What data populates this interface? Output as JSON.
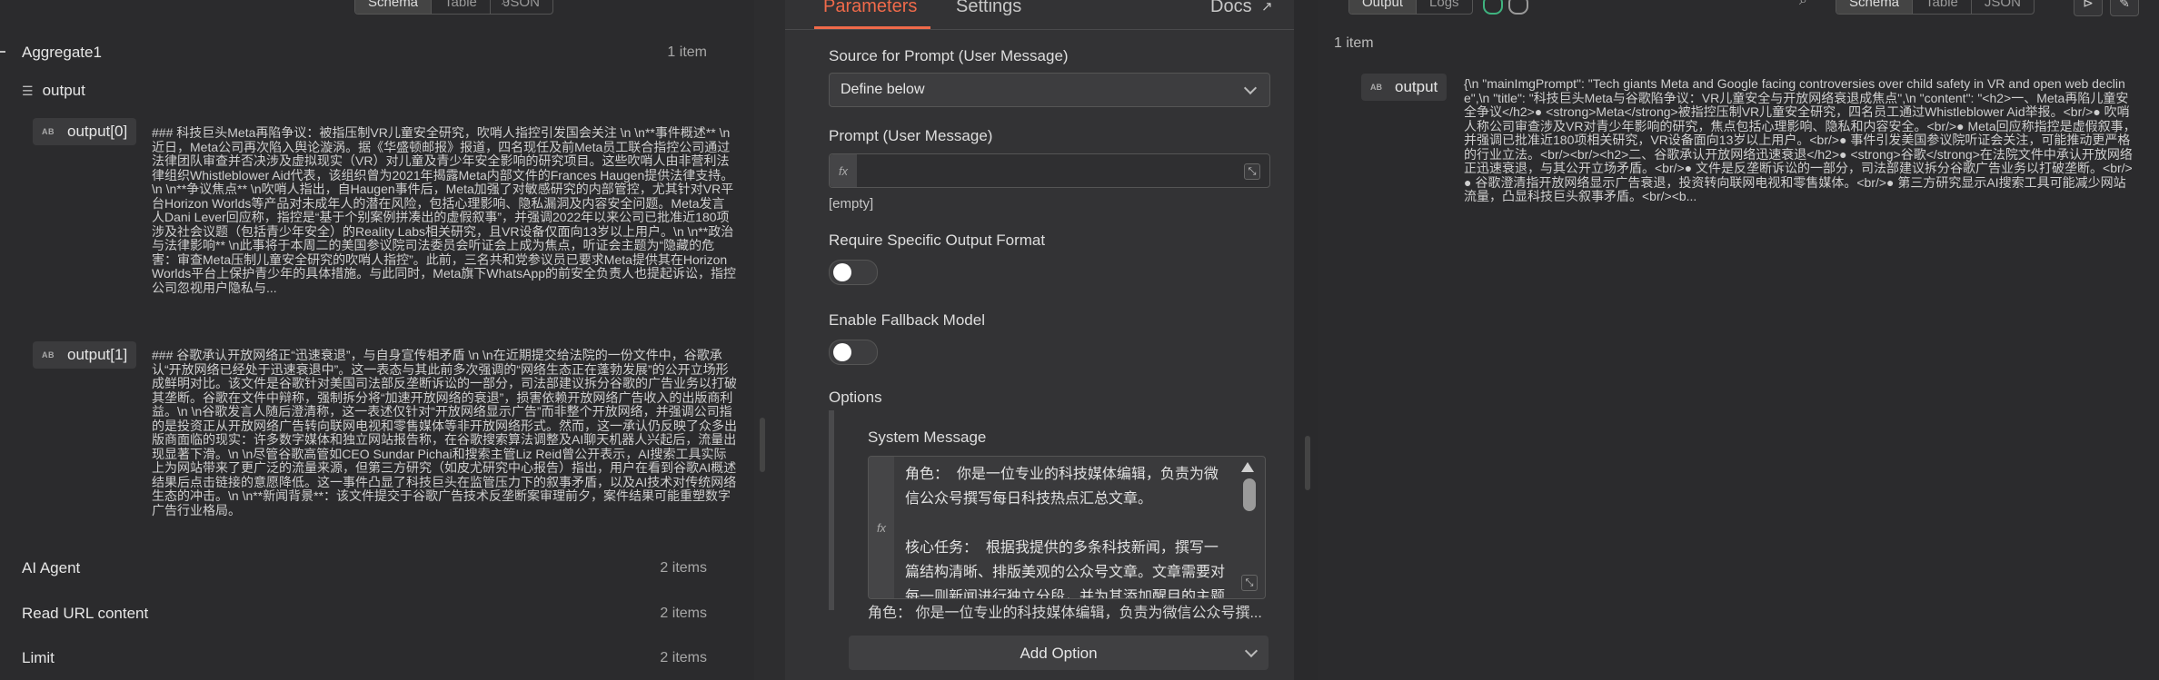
{
  "left": {
    "top_toggle": [
      "Schema",
      "Table",
      "JSON"
    ],
    "nodes": [
      {
        "name": "Aggregate1",
        "count": "1 item"
      },
      {
        "name": "AI Agent",
        "count": "2 items"
      },
      {
        "name": "Read URL content",
        "count": "2 items"
      },
      {
        "name": "Limit",
        "count": "2 items"
      }
    ],
    "output_label": "output",
    "output_icon": "list-icon",
    "field_type_badge": "AB",
    "item0": {
      "key": "output[0]",
      "text": "### 科技巨头Meta再陷争议：被指压制VR儿童安全研究，吹哨人指控引发国会关注 \\n \\n**事件概述** \\n近日，Meta公司再次陷入舆论漩涡。据《华盛顿邮报》报道，四名现任及前Meta员工联合指控公司通过法律团队审查并否决涉及虚拟现实（VR）对儿童及青少年安全影响的研究项目。这些吹哨人由非营利法律组织Whistleblower Aid代表，该组织曾为2021年揭露Meta内部文件的Frances Haugen提供法律支持。\\n \\n**争议焦点** \\n吹哨人指出，自Haugen事件后，Meta加强了对敏感研究的内部管控，尤其针对VR平台Horizon Worlds等产品对未成年人的潜在风险，包括心理影响、隐私漏洞及内容安全问题。Meta发言人Dani Lever回应称，指控是“基于个别案例拼凑出的虚假叙事”，并强调2022年以来公司已批准近180项涉及社会议题（包括青少年安全）的Reality Labs相关研究，且VR设备仅面向13岁以上用户。\\n \\n**政治与法律影响** \\n此事将于本周二的美国参议院司法委员会听证会上成为焦点，听证会主题为“隐藏的危害：审查Meta压制儿童安全研究的吹哨人指控”。此前，三名共和党参议员已要求Meta提供其在Horizon Worlds平台上保护青少年的具体措施。与此同时，Meta旗下WhatsApp的前安全负责人也提起诉讼，指控公司忽视用户隐私与..."
    },
    "item1": {
      "key": "output[1]",
      "text": "### 谷歌承认开放网络正“迅速衰退”，与自身宣传相矛盾 \\n \\n在近期提交给法院的一份文件中，谷歌承认“开放网络已经处于迅速衰退中”。这一表态与其此前多次强调的“网络生态正在蓬勃发展”的公开立场形成鲜明对比。该文件是谷歌针对美国司法部反垄断诉讼的一部分，司法部建议拆分谷歌的广告业务以打破其垄断。谷歌在文件中辩称，强制拆分将“加速开放网络的衰退”，损害依赖开放网络广告收入的出版商利益。\\n \\n谷歌发言人随后澄清称，这一表述仅针对“开放网络显示广告”而非整个开放网络，并强调公司指的是投资正从开放网络广告转向联网电视和零售媒体等非开放网络形式。然而，这一承认仍反映了众多出版商面临的现实：许多数字媒体和独立网站报告称，在谷歌搜索算法调整及AI聊天机器人兴起后，流量出现显著下滑。\\n \\n尽管谷歌高管如CEO Sundar Pichai和搜索主管Liz Reid曾公开表示，AI搜索工具实际上为网站带来了更广泛的流量来源，但第三方研究（如皮尤研究中心报告）指出，用户在看到谷歌AI概述结果后点击链接的意愿降低。这一事件凸显了科技巨头在监管压力下的叙事矛盾，以及AI技术对传统网络生态的冲击。\\n \\n**新闻背景**：该文件提交于谷歌广告技术反垄断案审理前夕，案件结果可能重塑数字广告行业格局。"
    }
  },
  "center": {
    "tabs": {
      "parameters": "Parameters",
      "settings": "Settings",
      "docs": "Docs"
    },
    "source_label": "Source for Prompt (User Message)",
    "source_value": "Define below",
    "prompt_label": "Prompt (User Message)",
    "fx": "fx",
    "empty_text": "[empty]",
    "require_format_label": "Require Specific Output Format",
    "fallback_label": "Enable Fallback Model",
    "options_title": "Options",
    "system_message_label": "System Message",
    "system_message_text": "角色：  你是一位专业的科技媒体编辑，负责为微信公众号撰写每日科技热点汇总文章。\n\n核心任务：  根据我提供的多条科技新闻，撰写一篇结构清晰、排版美观的公众号文章。文章需要对每一则新闻进行独立分段，并为其添加醒目的主题标题和",
    "system_message_preview": "角色：  你是一位专业的科技媒体编辑，负责为微信公众号撰...",
    "add_option_label": "Add Option",
    "require_format_on": false,
    "fallback_on": false
  },
  "right": {
    "top_toggle": [
      "Output",
      "Logs"
    ],
    "top_toggle2": [
      "Schema",
      "Table",
      "JSON"
    ],
    "items_count": "1 item",
    "output_key": "output",
    "field_type_badge": "AB",
    "output_text": "{\\n \"mainImgPrompt\": \"Tech giants Meta and Google facing controversies over child safety in VR and open web decline\",\\n \"title\": \"科技巨头Meta与谷歌陷争议：VR儿童安全与开放网络衰退成焦点\",\\n \"content\": \"<h2>一、Meta再陷儿童安全争议</h2>● <strong>Meta</strong>被指控压制VR儿童安全研究，四名员工通过Whistleblower Aid举报。<br/>● 吹哨人称公司审查涉及VR对青少年影响的研究，焦点包括心理影响、隐私和内容安全。<br/>● Meta回应称指控是虚假叙事，并强调已批准近180项相关研究，VR设备面向13岁以上用户。<br/>● 事件引发美国参议院听证会关注，可能推动更严格的行业立法。<br/><br/><h2>二、谷歌承认开放网络迅速衰退</h2>● <strong>谷歌</strong>在法院文件中承认开放网络正迅速衰退，与其公开立场矛盾。<br/>● 文件是反垄断诉讼的一部分，司法部建议拆分谷歌广告业务以打破垄断。<br/>● 谷歌澄清指开放网络显示广告衰退，投资转向联网电视和零售媒体。<br/>● 第三方研究显示AI搜索工具可能减少网站流量，凸显科技巨头叙事矛盾。<br/><b..."
  },
  "colors": {
    "accent": "#f06a4a",
    "success": "#3fb37f"
  }
}
